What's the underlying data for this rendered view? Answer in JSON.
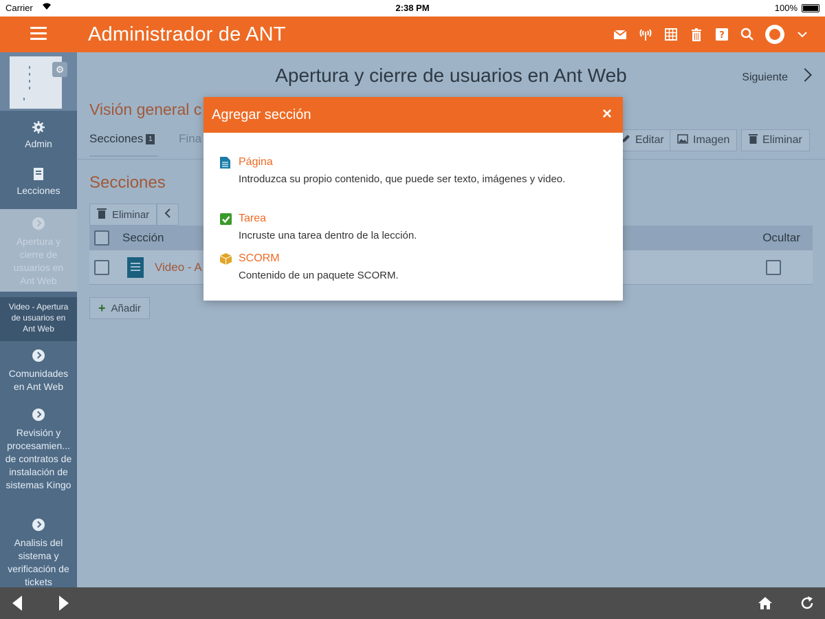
{
  "status": {
    "carrier": "Carrier",
    "time": "2:38 PM",
    "battery": "100%"
  },
  "header": {
    "title": "Administrador de ANT",
    "icons": [
      "mail-icon",
      "antenna-icon",
      "grid-icon",
      "trash-icon",
      "help-icon",
      "search-icon",
      "avatar",
      "chevron-down-icon"
    ]
  },
  "sidebar": {
    "admin_label": "Admin",
    "lessons_label": "Lecciones",
    "items": [
      {
        "label": "Apertura y cierre de usuarios en Ant Web",
        "active": true
      },
      {
        "label": "Video - Apertura de usuarios en Ant Web",
        "sub": true
      },
      {
        "label": "Comunidades en Ant Web"
      },
      {
        "label": "Revisión y procesamien... de contratos de instalación de sistemas Kingo"
      },
      {
        "label": "Analisis del sistema y verificación de tickets"
      }
    ]
  },
  "main": {
    "lesson_title": "Apertura y cierre de usuarios en Ant Web",
    "next_label": "Siguiente",
    "overview_title": "Visión general c",
    "tabs": {
      "sections": "Secciones",
      "sections_count": "1",
      "fina": "Fina"
    },
    "actions": {
      "edit": "Editar",
      "image": "Imagen",
      "delete": "Eliminar"
    },
    "sections_heading": "Secciones",
    "toolbar": {
      "delete": "Eliminar"
    },
    "table": {
      "col_section": "Sección",
      "col_hide": "Ocultar",
      "rows": [
        {
          "title": "Video - A"
        }
      ]
    },
    "add_label": "Añadir"
  },
  "modal": {
    "title": "Agregar sección",
    "close": "×",
    "options": [
      {
        "label": "Página",
        "desc": "Introduzca su propio contenido, que puede ser texto, imágenes y video.",
        "icon": "page-icon"
      },
      {
        "label": "Tarea",
        "desc": "Incruste una tarea dentro de la lección.",
        "icon": "task-check-icon"
      },
      {
        "label": "SCORM",
        "desc": "Contenido de un paquete SCORM.",
        "icon": "package-icon"
      }
    ]
  },
  "colors": {
    "accent": "#ee6a24",
    "sidebar": "#4f6b86",
    "overlay": "#9fb3c6"
  }
}
